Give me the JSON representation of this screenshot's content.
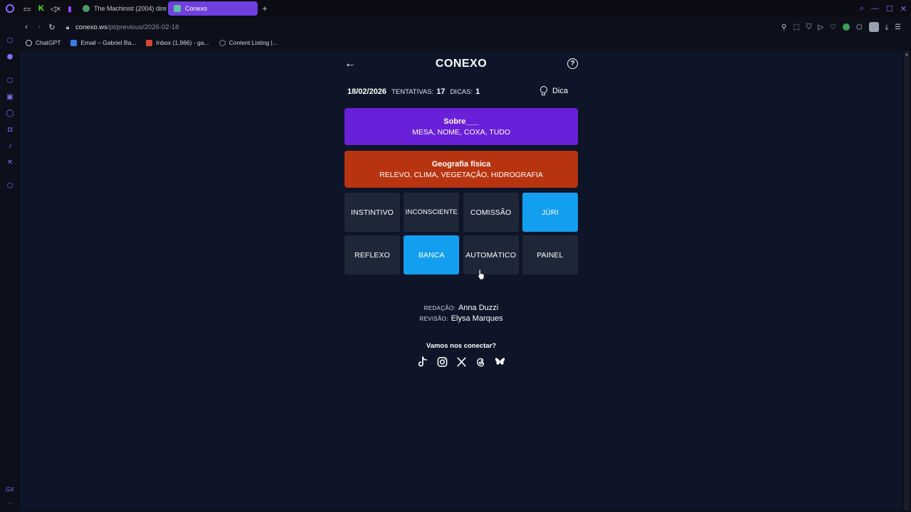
{
  "browser": {
    "tabs": [
      {
        "label": "The Machinist (2004) dire",
        "active": false
      },
      {
        "label": "Conexo",
        "active": true
      }
    ],
    "url": {
      "host": "conexo.ws",
      "path": "/pt/previous/2026-02-18"
    },
    "bookmarks": [
      "ChatGPT",
      "Email – Gabriel Ba...",
      "Inbox (1,966) - ga...",
      "Content Listing |..."
    ]
  },
  "game": {
    "title": "CONEXO",
    "date": "18/02/2026",
    "attempts_label": "TENTATIVAS:",
    "attempts": "17",
    "hints_label": "DICAS:",
    "hints": "1",
    "hint_button": "Dica",
    "groups": [
      {
        "title": "Sobre___",
        "words": "MESA, NOME, COXA, TUDO",
        "color": "#6a1fd8"
      },
      {
        "title": "Geografia física",
        "words": "RELEVO, CLIMA, VEGETAÇÃO, HIDROGRAFIA",
        "color": "#b83411"
      }
    ],
    "cells": [
      {
        "label": "INSTINTIVO",
        "selected": false
      },
      {
        "label": "INCONSCIENTE",
        "selected": false
      },
      {
        "label": "COMISSÃO",
        "selected": false
      },
      {
        "label": "JÚRI",
        "selected": true
      },
      {
        "label": "REFLEXO",
        "selected": false
      },
      {
        "label": "BANCA",
        "selected": true
      },
      {
        "label": "AUTOMÁTICO",
        "selected": false
      },
      {
        "label": "PAINEL",
        "selected": false
      }
    ],
    "credits": {
      "editor_label": "REDAÇÃO:",
      "editor": "Anna Duzzi",
      "reviewer_label": "REVISÃO:",
      "reviewer": "Elysa Marques"
    },
    "connect": "Vamos nos conectar?",
    "socials": [
      "tiktok-icon",
      "instagram-icon",
      "x-icon",
      "threads-icon",
      "bluesky-icon"
    ]
  },
  "colors": {
    "selected": "#139ff0",
    "cell": "#1e2738",
    "page_bg": "#0e1528",
    "accent": "#8d6bff"
  }
}
